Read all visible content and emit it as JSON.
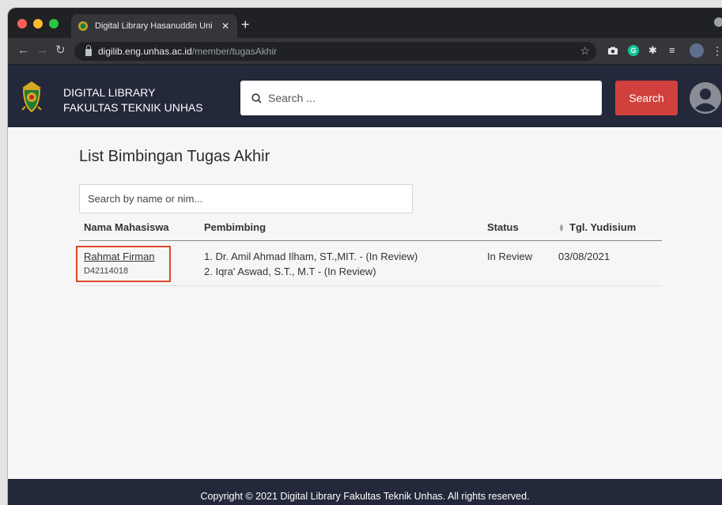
{
  "browser": {
    "tab_title": "Digital Library Hasanuddin Uni",
    "tab_close": "✕",
    "new_tab": "+",
    "url_host": "digilib.eng.unhas.ac.id",
    "url_path": "/member/tugasAkhir"
  },
  "header": {
    "brand_line1": "DIGITAL LIBRARY",
    "brand_line2": "FAKULTAS TEKNIK UNHAS",
    "search_placeholder": "Search ...",
    "search_button": "Search"
  },
  "main": {
    "title": "List Bimbingan Tugas Akhir",
    "filter_placeholder": "Search by name or nim...",
    "columns": [
      "Nama Mahasiswa",
      "Pembimbing",
      "Status",
      "Tgl. Yudisium"
    ],
    "rows": [
      {
        "name": "Rahmat Firman",
        "nim": "D42114018",
        "pembimbing": [
          "1. Dr. Amil Ahmad Ilham, ST.,MIT. - (In Review)",
          "2. Iqra' Aswad, S.T., M.T - (In Review)"
        ],
        "status": "In Review",
        "tgl": "03/08/2021"
      }
    ]
  },
  "footer": {
    "copyright": "Copyright © 2021 Digital Library Fakultas Teknik Unhas. All rights reserved."
  },
  "colors": {
    "header_bg": "#23283a",
    "search_button": "#d0403c",
    "highlight_box": "#d94a2b"
  },
  "icons": {
    "search": "search-icon",
    "user": "user-avatar-icon",
    "sort": "sort-icon",
    "lock": "lock-icon"
  }
}
